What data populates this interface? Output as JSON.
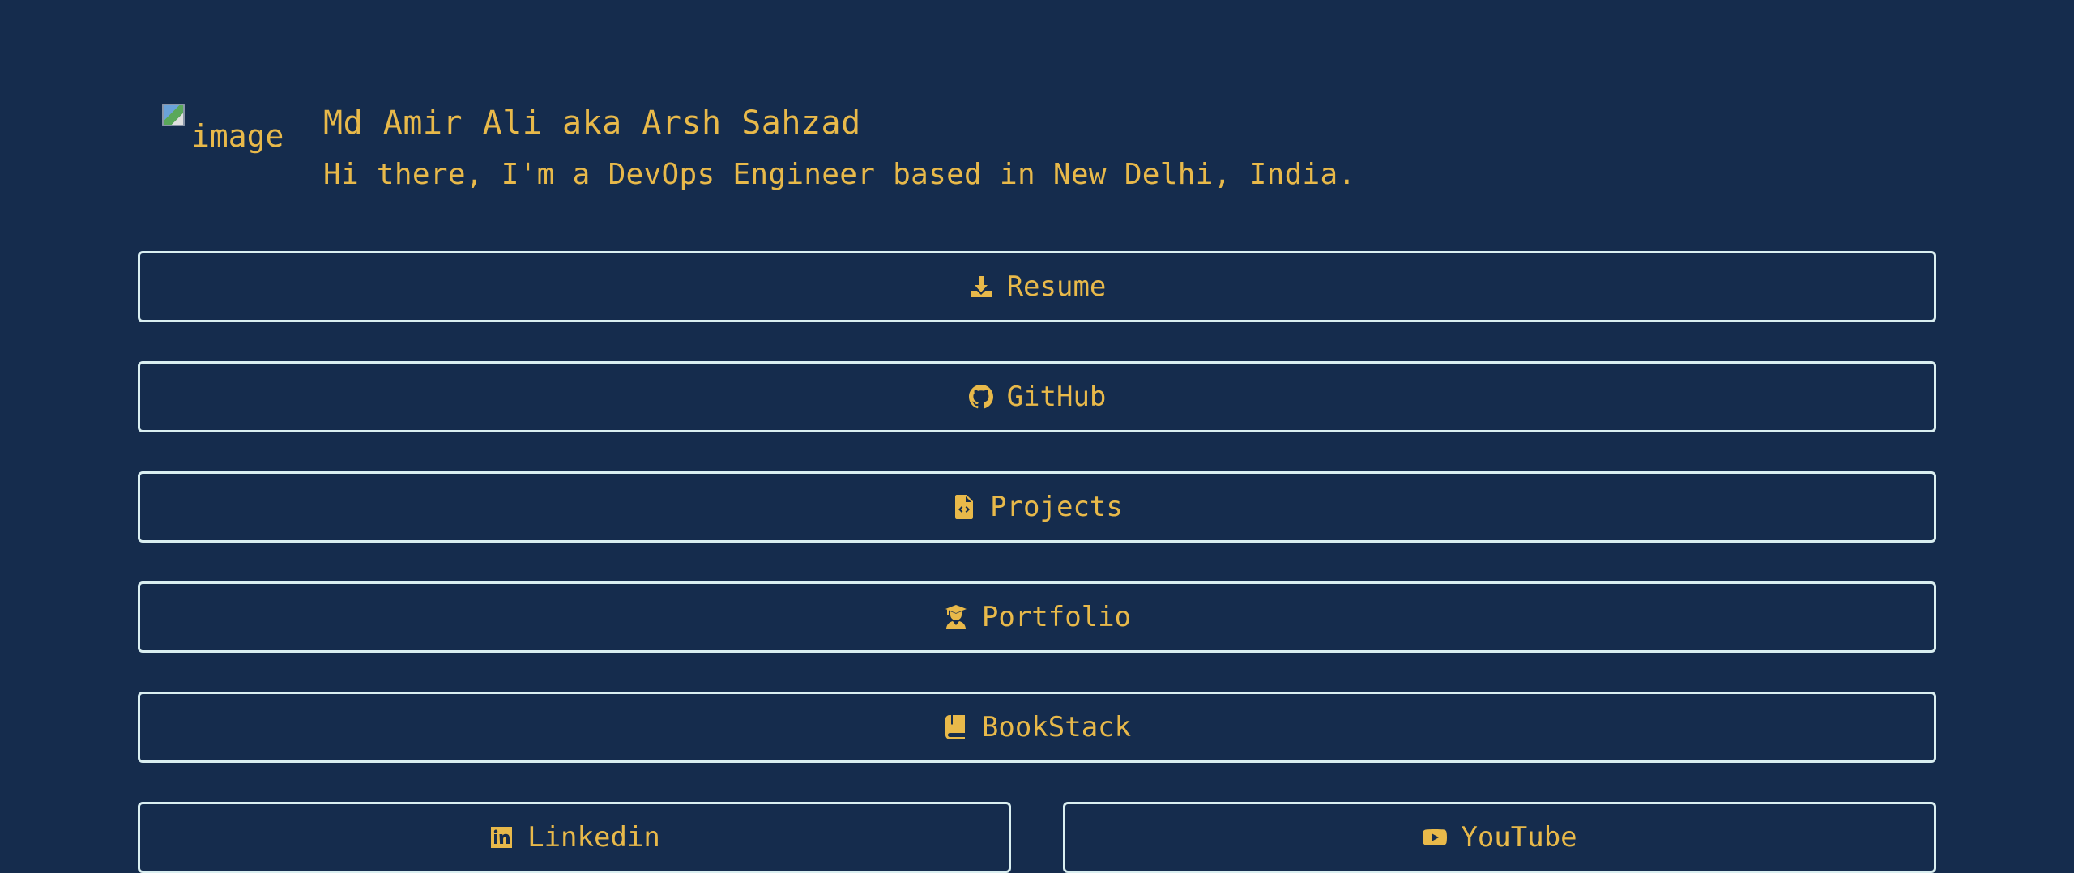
{
  "profile": {
    "image_alt": "image",
    "name": "Md Amir Ali aka Arsh Sahzad",
    "tagline": "Hi there, I'm a DevOps Engineer based in New Delhi, India."
  },
  "links": {
    "resume": {
      "label": "Resume",
      "icon": "download-icon"
    },
    "github": {
      "label": "GitHub",
      "icon": "github-icon"
    },
    "projects": {
      "label": "Projects",
      "icon": "file-code-icon"
    },
    "portfolio": {
      "label": "Portfolio",
      "icon": "graduate-icon"
    },
    "bookstack": {
      "label": "BookStack",
      "icon": "book-icon"
    },
    "linkedin": {
      "label": "Linkedin",
      "icon": "linkedin-icon"
    },
    "youtube": {
      "label": "YouTube",
      "icon": "youtube-icon"
    }
  },
  "colors": {
    "background": "#152c4d",
    "accent": "#e8b94a",
    "border": "#d9eef0"
  }
}
